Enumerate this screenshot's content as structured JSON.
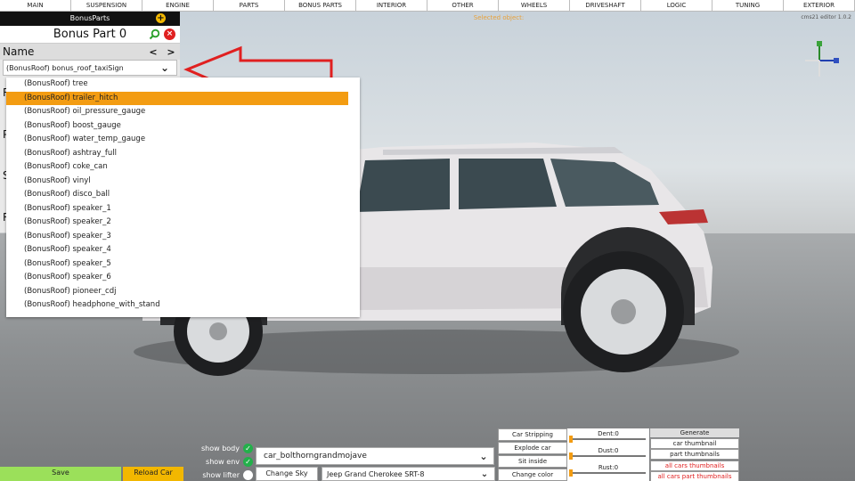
{
  "menu": [
    "MAIN",
    "SUSPENSION",
    "ENGINE",
    "PARTS",
    "BONUS PARTS",
    "INTERIOR",
    "OTHER",
    "WHEELS",
    "DRIVESHAFT",
    "LOGIC",
    "TUNING",
    "EXTERIOR"
  ],
  "status_text": "Selected object:",
  "version": "cms21 editor 1.0.2",
  "panel": {
    "title": "BonusParts",
    "add_icon": "plus-icon",
    "part_name": "Bonus Part 0",
    "name_label": "Name",
    "prev": "<",
    "next": ">",
    "selected_part": "(BonusRoof) bonus_roof_taxiSign",
    "hidden_labels": [
      "R",
      "P",
      "S",
      "R"
    ]
  },
  "dropdown_items": [
    "(BonusRoof) tree",
    "(BonusRoof) trailer_hitch",
    "(BonusRoof) oil_pressure_gauge",
    "(BonusRoof) boost_gauge",
    "(BonusRoof) water_temp_gauge",
    "(BonusRoof) ashtray_full",
    "(BonusRoof) coke_can",
    "(BonusRoof) vinyl",
    "(BonusRoof) disco_ball",
    "(BonusRoof) speaker_1",
    "(BonusRoof) speaker_2",
    "(BonusRoof) speaker_3",
    "(BonusRoof) speaker_4",
    "(BonusRoof) speaker_5",
    "(BonusRoof) speaker_6",
    "(BonusRoof) pioneer_cdj",
    "(BonusRoof) headphone_with_stand"
  ],
  "highlighted_index": 1,
  "checks": [
    {
      "label": "show body",
      "on": true
    },
    {
      "label": "show env",
      "on": true
    },
    {
      "label": "show lifter",
      "on": false
    }
  ],
  "buttons": {
    "save": "Save",
    "reload": "Reload Car",
    "change_sky": "Change Sky"
  },
  "car_select": "car_bolthorngrandmojave",
  "car_model": "Jeep Grand Cherokee SRT-8",
  "options": [
    "Car Stripping",
    "Explode car",
    "Sit inside",
    "Change color"
  ],
  "sliders": [
    "Dent:0",
    "Dust:0",
    "Rust:0"
  ],
  "generate": {
    "header": "Generate",
    "buttons": [
      {
        "label": "car thumbnail",
        "red": false
      },
      {
        "label": "part thumbnails",
        "red": false
      },
      {
        "label": "all cars thumbnails",
        "red": true
      },
      {
        "label": "all cars part thumbnails",
        "red": true
      }
    ]
  },
  "colors": {
    "accent": "#f39c12",
    "save": "#9be05a",
    "reload": "#f2b700",
    "danger": "#e02020",
    "ok": "#23b04a"
  }
}
